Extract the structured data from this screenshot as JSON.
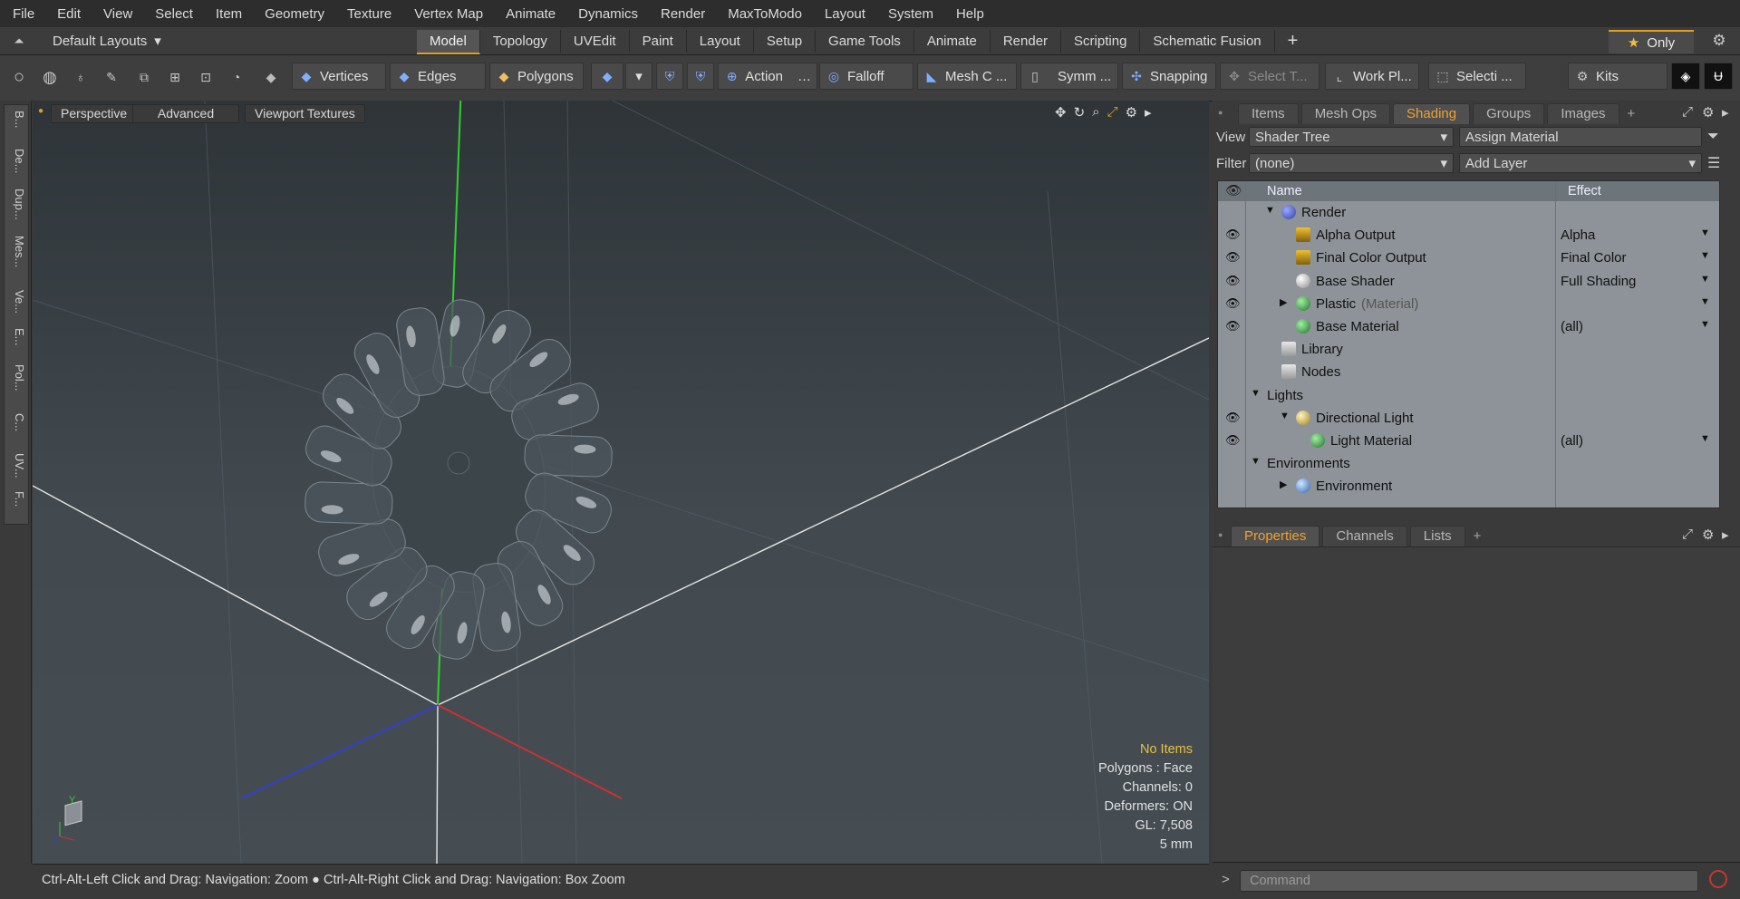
{
  "menu": [
    "File",
    "Edit",
    "View",
    "Select",
    "Item",
    "Geometry",
    "Texture",
    "Vertex Map",
    "Animate",
    "Dynamics",
    "Render",
    "MaxToModo",
    "Layout",
    "System",
    "Help"
  ],
  "layout": {
    "selector": "Default Layouts",
    "tabs": [
      "Model",
      "Topology",
      "UVEdit",
      "Paint",
      "Layout",
      "Setup",
      "Game Tools",
      "Animate",
      "Render",
      "Scripting",
      "Schematic Fusion"
    ],
    "active_tab": "Model",
    "only_label": "Only"
  },
  "toolbar": {
    "vertices": "Vertices",
    "edges": "Edges",
    "polygons": "Polygons",
    "action": "Action",
    "falloff": "Falloff",
    "mesh": "Mesh C ...",
    "symmetry": "Symm ...",
    "snapping": "Snapping",
    "select_t": "Select T...",
    "workplane": "Work Pl...",
    "selection": "Selecti ...",
    "kits": "Kits"
  },
  "left_strip": [
    "B...",
    "De...",
    "Dup...",
    "Mes...",
    "Ve...",
    "E...",
    "Pol...",
    "C...",
    "UV...",
    "F..."
  ],
  "viewport": {
    "perspective": "Perspective",
    "advanced": "Advanced",
    "textures": "Viewport Textures",
    "info": {
      "items": "No Items",
      "polygons": "Polygons : Face",
      "channels": "Channels: 0",
      "deformers": "Deformers: ON",
      "gl": "GL: 7,508",
      "scale": "5 mm"
    },
    "axis_y": "Y"
  },
  "status": {
    "left": "Ctrl-Alt-Left Click and Drag: Navigation: Zoom",
    "right": "Ctrl-Alt-Right Click and Drag: Navigation: Box Zoom"
  },
  "panel": {
    "tabs": [
      "Items",
      "Mesh Ops",
      "Shading",
      "Groups",
      "Images"
    ],
    "active_tab": "Shading",
    "view_label": "View",
    "view_value": "Shader Tree",
    "assign_material": "Assign Material",
    "filter_label": "Filter",
    "filter_value": "(none)",
    "add_layer": "Add Layer",
    "col_name": "Name",
    "col_effect": "Effect",
    "rows": [
      {
        "label": "Render",
        "effect": "",
        "icon": "render-icon",
        "indent": 1,
        "eye": false
      },
      {
        "label": "Alpha Output",
        "effect": "Alpha",
        "icon": "output-icon",
        "indent": 2,
        "eye": true
      },
      {
        "label": "Final Color Output",
        "effect": "Final Color",
        "icon": "output-icon",
        "indent": 2,
        "eye": true
      },
      {
        "label": "Base Shader",
        "effect": "Full Shading",
        "icon": "shader-icon",
        "indent": 2,
        "eye": true
      },
      {
        "label": "Plastic",
        "suffix": "(Material)",
        "effect": "",
        "icon": "material-icon",
        "indent": 2,
        "eye": true
      },
      {
        "label": "Base Material",
        "effect": "(all)",
        "icon": "material-icon",
        "indent": 2,
        "eye": true
      },
      {
        "label": "Library",
        "effect": "",
        "icon": "folder-icon",
        "indent": 1,
        "eye": false
      },
      {
        "label": "Nodes",
        "effect": "",
        "icon": "folder-icon",
        "indent": 1,
        "eye": false
      },
      {
        "label": "Lights",
        "effect": "",
        "icon": "",
        "indent": 0,
        "eye": false
      },
      {
        "label": "Directional Light",
        "effect": "",
        "icon": "light-icon",
        "indent": 2,
        "eye": true
      },
      {
        "label": "Light Material",
        "effect": "(all)",
        "icon": "material-icon",
        "indent": 3,
        "eye": true
      },
      {
        "label": "Environments",
        "effect": "",
        "icon": "",
        "indent": 0,
        "eye": false
      },
      {
        "label": "Environment",
        "effect": "",
        "icon": "environment-icon",
        "indent": 2,
        "eye": false
      }
    ],
    "bottom_tabs": [
      "Properties",
      "Channels",
      "Lists"
    ],
    "bottom_active": "Properties",
    "command_placeholder": "Command"
  }
}
